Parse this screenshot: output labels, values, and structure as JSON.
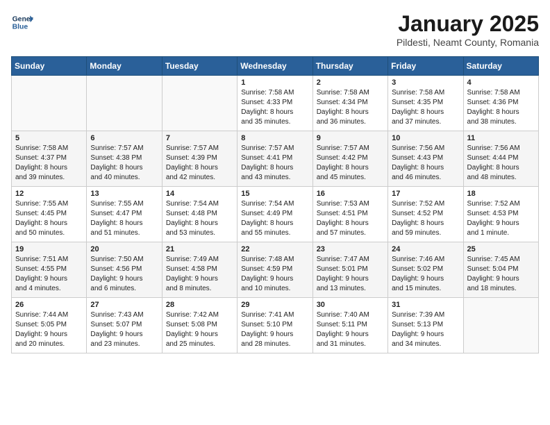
{
  "header": {
    "logo_line1": "General",
    "logo_line2": "Blue",
    "month": "January 2025",
    "location": "Pildesti, Neamt County, Romania"
  },
  "days_of_week": [
    "Sunday",
    "Monday",
    "Tuesday",
    "Wednesday",
    "Thursday",
    "Friday",
    "Saturday"
  ],
  "weeks": [
    [
      {
        "day": "",
        "info": ""
      },
      {
        "day": "",
        "info": ""
      },
      {
        "day": "",
        "info": ""
      },
      {
        "day": "1",
        "info": "Sunrise: 7:58 AM\nSunset: 4:33 PM\nDaylight: 8 hours\nand 35 minutes."
      },
      {
        "day": "2",
        "info": "Sunrise: 7:58 AM\nSunset: 4:34 PM\nDaylight: 8 hours\nand 36 minutes."
      },
      {
        "day": "3",
        "info": "Sunrise: 7:58 AM\nSunset: 4:35 PM\nDaylight: 8 hours\nand 37 minutes."
      },
      {
        "day": "4",
        "info": "Sunrise: 7:58 AM\nSunset: 4:36 PM\nDaylight: 8 hours\nand 38 minutes."
      }
    ],
    [
      {
        "day": "5",
        "info": "Sunrise: 7:58 AM\nSunset: 4:37 PM\nDaylight: 8 hours\nand 39 minutes."
      },
      {
        "day": "6",
        "info": "Sunrise: 7:57 AM\nSunset: 4:38 PM\nDaylight: 8 hours\nand 40 minutes."
      },
      {
        "day": "7",
        "info": "Sunrise: 7:57 AM\nSunset: 4:39 PM\nDaylight: 8 hours\nand 42 minutes."
      },
      {
        "day": "8",
        "info": "Sunrise: 7:57 AM\nSunset: 4:41 PM\nDaylight: 8 hours\nand 43 minutes."
      },
      {
        "day": "9",
        "info": "Sunrise: 7:57 AM\nSunset: 4:42 PM\nDaylight: 8 hours\nand 45 minutes."
      },
      {
        "day": "10",
        "info": "Sunrise: 7:56 AM\nSunset: 4:43 PM\nDaylight: 8 hours\nand 46 minutes."
      },
      {
        "day": "11",
        "info": "Sunrise: 7:56 AM\nSunset: 4:44 PM\nDaylight: 8 hours\nand 48 minutes."
      }
    ],
    [
      {
        "day": "12",
        "info": "Sunrise: 7:55 AM\nSunset: 4:45 PM\nDaylight: 8 hours\nand 50 minutes."
      },
      {
        "day": "13",
        "info": "Sunrise: 7:55 AM\nSunset: 4:47 PM\nDaylight: 8 hours\nand 51 minutes."
      },
      {
        "day": "14",
        "info": "Sunrise: 7:54 AM\nSunset: 4:48 PM\nDaylight: 8 hours\nand 53 minutes."
      },
      {
        "day": "15",
        "info": "Sunrise: 7:54 AM\nSunset: 4:49 PM\nDaylight: 8 hours\nand 55 minutes."
      },
      {
        "day": "16",
        "info": "Sunrise: 7:53 AM\nSunset: 4:51 PM\nDaylight: 8 hours\nand 57 minutes."
      },
      {
        "day": "17",
        "info": "Sunrise: 7:52 AM\nSunset: 4:52 PM\nDaylight: 8 hours\nand 59 minutes."
      },
      {
        "day": "18",
        "info": "Sunrise: 7:52 AM\nSunset: 4:53 PM\nDaylight: 9 hours\nand 1 minute."
      }
    ],
    [
      {
        "day": "19",
        "info": "Sunrise: 7:51 AM\nSunset: 4:55 PM\nDaylight: 9 hours\nand 4 minutes."
      },
      {
        "day": "20",
        "info": "Sunrise: 7:50 AM\nSunset: 4:56 PM\nDaylight: 9 hours\nand 6 minutes."
      },
      {
        "day": "21",
        "info": "Sunrise: 7:49 AM\nSunset: 4:58 PM\nDaylight: 9 hours\nand 8 minutes."
      },
      {
        "day": "22",
        "info": "Sunrise: 7:48 AM\nSunset: 4:59 PM\nDaylight: 9 hours\nand 10 minutes."
      },
      {
        "day": "23",
        "info": "Sunrise: 7:47 AM\nSunset: 5:01 PM\nDaylight: 9 hours\nand 13 minutes."
      },
      {
        "day": "24",
        "info": "Sunrise: 7:46 AM\nSunset: 5:02 PM\nDaylight: 9 hours\nand 15 minutes."
      },
      {
        "day": "25",
        "info": "Sunrise: 7:45 AM\nSunset: 5:04 PM\nDaylight: 9 hours\nand 18 minutes."
      }
    ],
    [
      {
        "day": "26",
        "info": "Sunrise: 7:44 AM\nSunset: 5:05 PM\nDaylight: 9 hours\nand 20 minutes."
      },
      {
        "day": "27",
        "info": "Sunrise: 7:43 AM\nSunset: 5:07 PM\nDaylight: 9 hours\nand 23 minutes."
      },
      {
        "day": "28",
        "info": "Sunrise: 7:42 AM\nSunset: 5:08 PM\nDaylight: 9 hours\nand 25 minutes."
      },
      {
        "day": "29",
        "info": "Sunrise: 7:41 AM\nSunset: 5:10 PM\nDaylight: 9 hours\nand 28 minutes."
      },
      {
        "day": "30",
        "info": "Sunrise: 7:40 AM\nSunset: 5:11 PM\nDaylight: 9 hours\nand 31 minutes."
      },
      {
        "day": "31",
        "info": "Sunrise: 7:39 AM\nSunset: 5:13 PM\nDaylight: 9 hours\nand 34 minutes."
      },
      {
        "day": "",
        "info": ""
      }
    ]
  ]
}
